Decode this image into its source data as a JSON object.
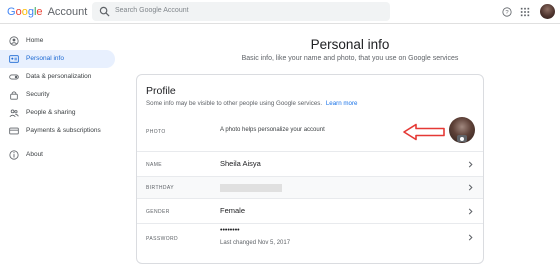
{
  "header": {
    "logo_letters": [
      "G",
      "o",
      "o",
      "g",
      "l",
      "e"
    ],
    "logo_suffix": "Account",
    "search_placeholder": "Search Google Account",
    "icons": [
      "search-icon",
      "help-icon",
      "apps-grid-icon"
    ]
  },
  "sidebar": {
    "items": [
      {
        "label": "Home",
        "icon": "person-circle-icon"
      },
      {
        "label": "Personal info",
        "icon": "id-card-icon",
        "active": true
      },
      {
        "label": "Data & personalization",
        "icon": "toggle-icon"
      },
      {
        "label": "Security",
        "icon": "lock-icon"
      },
      {
        "label": "People & sharing",
        "icon": "people-icon"
      },
      {
        "label": "Payments & subscriptions",
        "icon": "credit-card-icon"
      },
      {
        "label": "About",
        "icon": "info-icon"
      }
    ]
  },
  "main": {
    "title": "Personal info",
    "subtitle": "Basic info, like your name and photo, that you use on Google services"
  },
  "profile": {
    "title": "Profile",
    "description": "Some info may be visible to other people using Google services.",
    "learn_more": "Learn more",
    "photo_label": "PHOTO",
    "photo_hint": "A photo helps personalize your account",
    "rows": [
      {
        "label": "NAME",
        "value": ""
      },
      {
        "label": "BIRTHDAY",
        "value": ""
      },
      {
        "label": "GENDER",
        "value": "Female"
      },
      {
        "label": "PASSWORD",
        "value": "••••••••",
        "sub": "Last changed Nov 5, 2017"
      }
    ],
    "name_value": "Sheila Aisya"
  },
  "colors": {
    "accent": "#1a73e8",
    "active_nav_bg": "#e8f0fe",
    "annotation_arrow": "#e53935"
  }
}
